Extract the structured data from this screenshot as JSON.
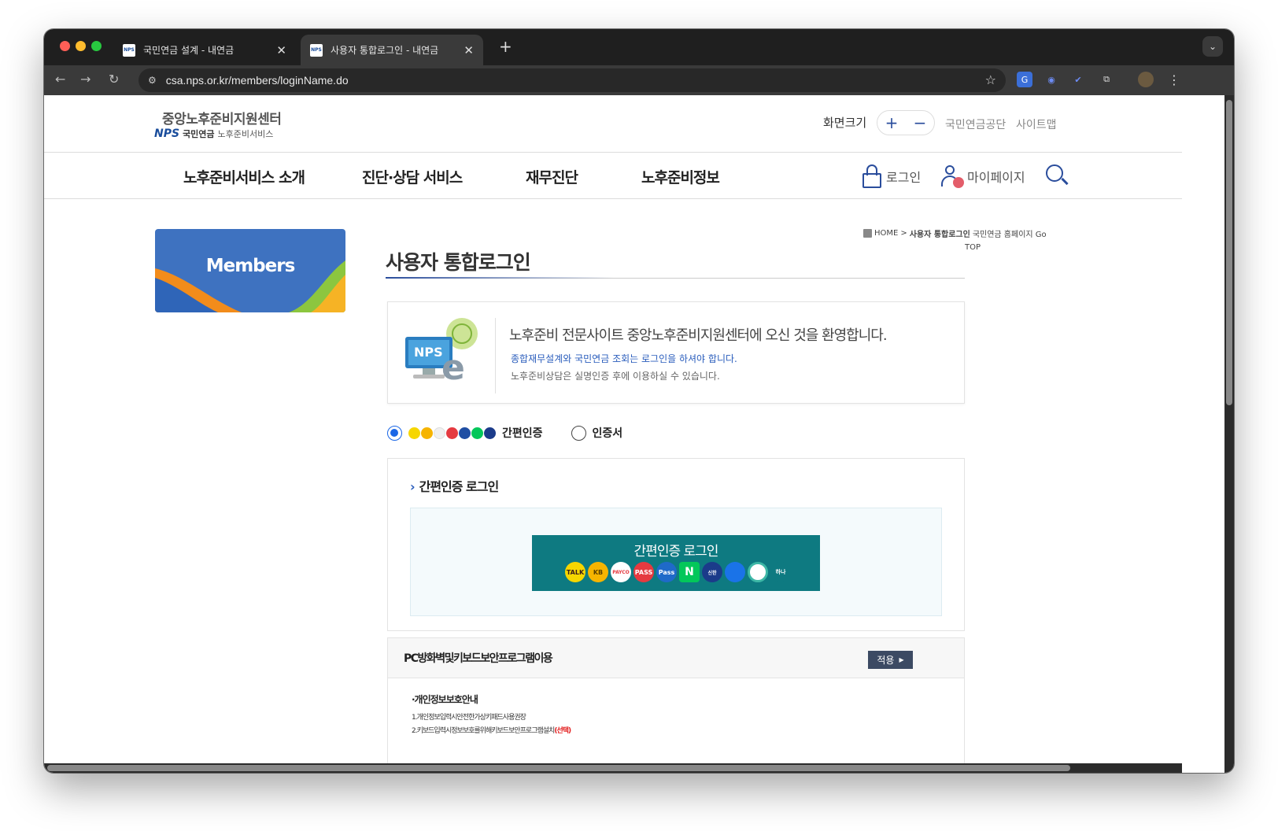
{
  "browser": {
    "tabs": [
      {
        "title": "국민연금 설계 - 내연금",
        "active": false
      },
      {
        "title": "사용자 통합로그인 - 내연금",
        "active": true
      }
    ],
    "url": "csa.nps.or.kr/members/loginName.do"
  },
  "header": {
    "logo_main": "중앙노후준비지원센터",
    "logo_nps": "NPS",
    "logo_nps_kr": "국민연금",
    "logo_service": "노후준비서비스",
    "fontsize_label": "화면크기",
    "fontsize_plus": "+",
    "fontsize_minus": "−",
    "link_nps": "국민연금공단",
    "link_sitemap": "사이트맵"
  },
  "gnb": {
    "items": [
      "노후준비서비스 소개",
      "진단·상담 서비스",
      "재무진단",
      "노후준비정보"
    ],
    "login": "로그인",
    "mypage": "마이페이지"
  },
  "sidebar": {
    "banner": "Members"
  },
  "breadcrumb": {
    "home": "HOME",
    "separator": ">",
    "current": "사용자 통합로그인",
    "extra": "국민연금 홈페이지 Go",
    "top": "TOP"
  },
  "main": {
    "title": "사용자 통합로그인",
    "welcome": {
      "heading": "노후준비 전문사이트 중앙노후준비지원센터에 오신 것을 환영합니다.",
      "notice_blue": "종합재무설계와 국민연금 조회는 로그인을 하셔야 합니다.",
      "notice_gray": "노후준비상담은 실명인증 후에 이용하실 수 있습니다.",
      "image_label": "NPS"
    },
    "auth_options": {
      "option1": "간편인증",
      "option2": "인증서",
      "selected": "간편인증"
    },
    "easy_login": {
      "title": "간편인증 로그인",
      "button_label": "간편인증 로그인",
      "provider_labels": [
        "TALK",
        "KB",
        "PAYCO",
        "PASS",
        "Pass",
        "N",
        "신한",
        "",
        "",
        "하나"
      ]
    },
    "security": {
      "title": "PC방화벽및키보드보안프로그램이용",
      "apply_button": "적용",
      "privacy_heading": "·개인정보보호안내",
      "line1": "1.개인정보입력시안전한가상키패드사용권장",
      "line2": "2.키보드입력시정보보호를위해키보드보안프로그램설치",
      "line2_emphasis": "(선택)"
    }
  },
  "colors": {
    "brand_blue": "#2a4d9c",
    "teal_button": "#0e7a81",
    "banner_blue": "#3e72c0",
    "apply_button": "#3c4a63"
  }
}
